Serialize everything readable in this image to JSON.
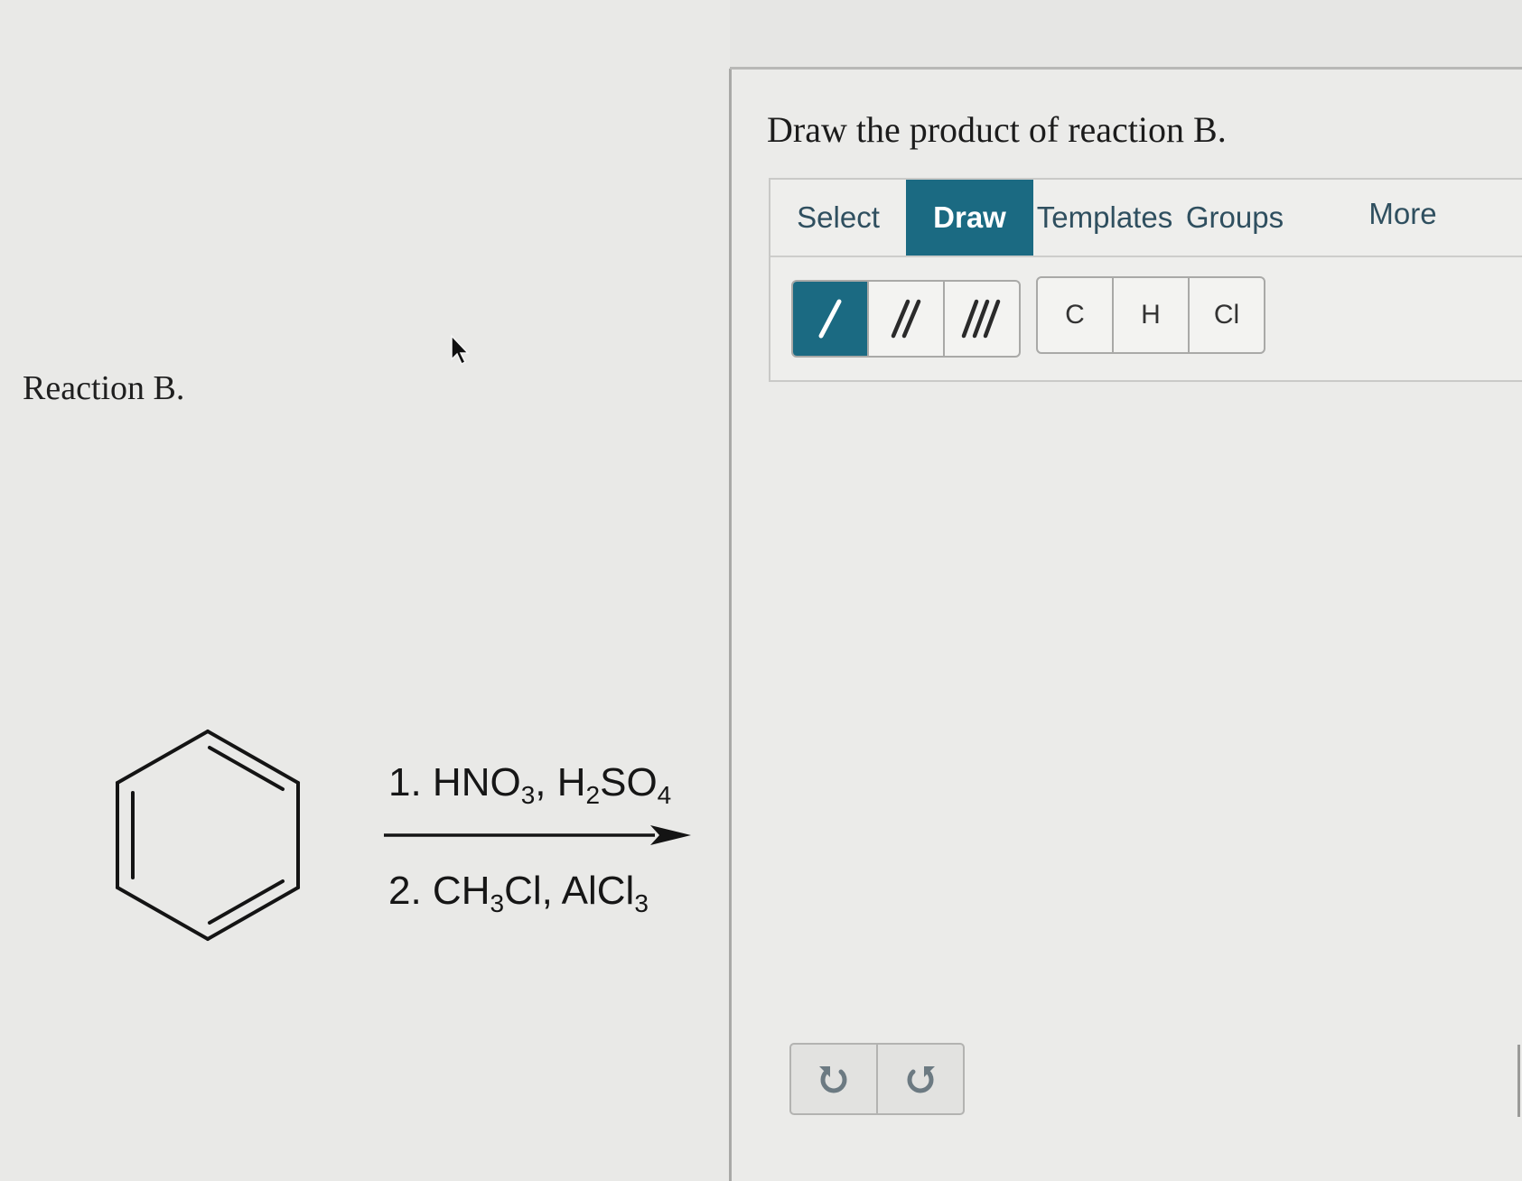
{
  "reaction": {
    "label": "Reaction B.",
    "step1": {
      "prefix": "1. HNO",
      "s1": "3",
      "mid": ", H",
      "s2": "2",
      "mid2": "SO",
      "s3": "4"
    },
    "step2": {
      "prefix": "2. CH",
      "s1": "3",
      "mid": "Cl, AlCl",
      "s2": "3"
    }
  },
  "question": {
    "text": "Draw the product of reaction B."
  },
  "tabs": [
    {
      "label": "Select"
    },
    {
      "label": "Draw",
      "active": true
    },
    {
      "label": "Templates"
    },
    {
      "label": "Groups"
    },
    {
      "label": "More"
    }
  ],
  "bond_tools": [
    {
      "icon": "single-bond-icon",
      "active": true
    },
    {
      "icon": "double-bond-icon"
    },
    {
      "icon": "triple-bond-icon"
    }
  ],
  "atom_tools": [
    {
      "label": "C"
    },
    {
      "label": "H"
    },
    {
      "label": "Cl"
    }
  ],
  "history": [
    {
      "icon": "undo-icon"
    },
    {
      "icon": "redo-icon"
    }
  ],
  "colors": {
    "accent": "#1b6a82",
    "tab_text": "#2f4f5f",
    "background": "#e9e9e7"
  }
}
